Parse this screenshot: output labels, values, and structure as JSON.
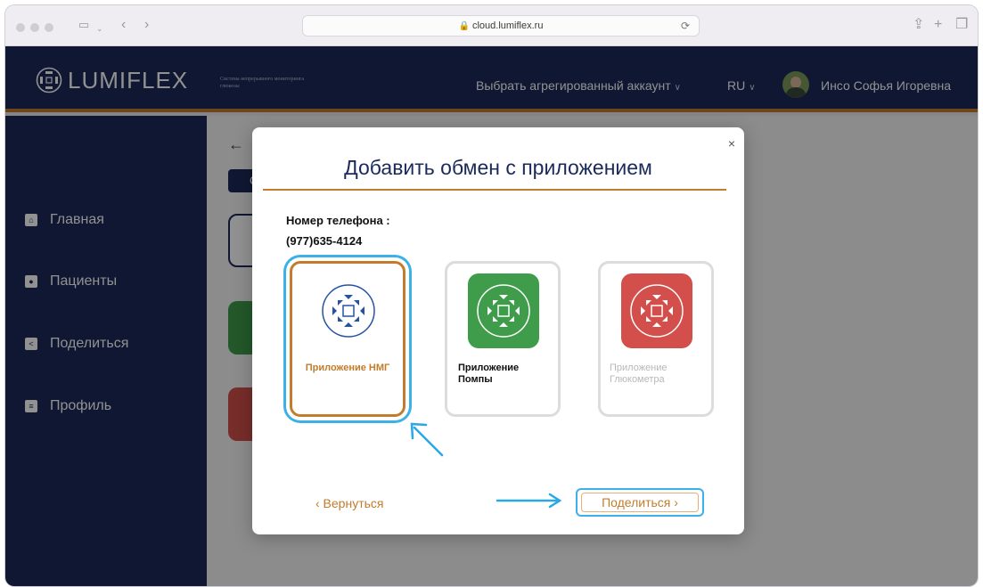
{
  "browser": {
    "url": "cloud.lumiflex.ru",
    "nav_back": "‹",
    "nav_forward": "›",
    "share_icon": "share-icon",
    "new_tab": "+",
    "tabs_icon": "tabs-overview-icon"
  },
  "header": {
    "logo_text": "LUMIFLEX",
    "logo_subtitle": "Система непрерывного мониторинга глюкозы",
    "account_selector": "Выбрать агрегированный аккаунт",
    "language": "RU",
    "user_name": "Инсо Софья Игоревна"
  },
  "sidebar": {
    "items": [
      {
        "label": "Главная",
        "icon": "home-icon"
      },
      {
        "label": "Пациенты",
        "icon": "patients-icon"
      },
      {
        "label": "Поделиться",
        "icon": "share-icon"
      },
      {
        "label": "Профиль",
        "icon": "profile-icon"
      }
    ]
  },
  "main": {
    "back_arrow": "←",
    "button_initial": "С"
  },
  "modal": {
    "title": "Добавить обмен с приложением",
    "close": "×",
    "phone_label": "Номер телефона :",
    "phone_value": "(977)635-4124",
    "apps": [
      {
        "label": "Приложение НМГ",
        "selected": true,
        "color": "#ffffff"
      },
      {
        "label": "Приложение Помпы",
        "selected": false,
        "color": "#3f9c4a"
      },
      {
        "label": "Приложение Глюкометра",
        "selected": false,
        "color": "#d24f4b",
        "disabled": true
      }
    ],
    "back_button": "‹ Вернуться",
    "share_button": "Поделиться ›"
  },
  "colors": {
    "navy": "#1b2a5a",
    "accent": "#c27c2c",
    "highlight": "#3bb1e8"
  }
}
